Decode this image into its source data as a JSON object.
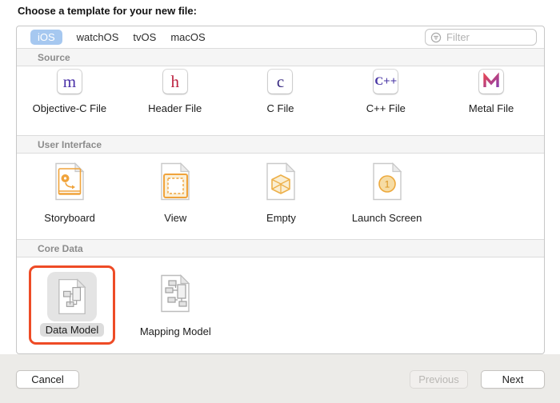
{
  "dialog": {
    "title": "Choose a template for your new file:",
    "tabs": [
      {
        "label": "iOS",
        "selected": true
      },
      {
        "label": "watchOS",
        "selected": false
      },
      {
        "label": "tvOS",
        "selected": false
      },
      {
        "label": "macOS",
        "selected": false
      }
    ],
    "filter": {
      "placeholder": "Filter",
      "icon": "filter-icon"
    },
    "sections": [
      {
        "title": "Source",
        "items": [
          {
            "label": "Objective-C File",
            "glyph": "m",
            "glyph_color": "#4a31a8"
          },
          {
            "label": "Header File",
            "glyph": "h",
            "glyph_color": "#bc2240"
          },
          {
            "label": "C File",
            "glyph": "c",
            "glyph_color": "#3a2c82"
          },
          {
            "label": "C++ File",
            "glyph": "C++",
            "glyph_color": "#4633a3"
          },
          {
            "label": "Metal File",
            "glyph": "M",
            "glyph_color": "gradient #e0455a to #8b3fae"
          }
        ]
      },
      {
        "title": "User Interface",
        "items": [
          {
            "label": "Storyboard",
            "icon": "storyboard-document-icon"
          },
          {
            "label": "View",
            "icon": "view-document-icon"
          },
          {
            "label": "Empty",
            "icon": "empty-cube-document-icon"
          },
          {
            "label": "Launch Screen",
            "icon": "launch-screen-document-icon",
            "badge": "1"
          }
        ]
      },
      {
        "title": "Core Data",
        "items": [
          {
            "label": "Data Model",
            "icon": "data-model-document-icon",
            "selected": true,
            "annotated": true
          },
          {
            "label": "Mapping Model",
            "icon": "mapping-model-document-icon",
            "selected": false
          }
        ]
      }
    ],
    "buttons": {
      "cancel": "Cancel",
      "previous": "Previous",
      "next": "Next"
    },
    "buttons_state": {
      "previous_disabled": true
    }
  },
  "colors": {
    "selected_tab_pill": "#a6c8f0",
    "annotation_highlight": "#ee4b26",
    "section_header_bg": "#f5f5f5",
    "ui_icon_orange": "#f0a33b",
    "selected_item_bg": "#e4e4e4",
    "bottom_bar_bg": "#ecebe8"
  }
}
